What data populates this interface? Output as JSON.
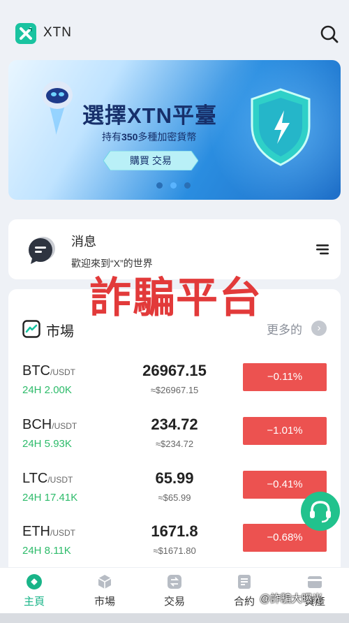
{
  "header": {
    "app_name": "XTN",
    "logo_icon": "xtn-logo-icon",
    "search_icon": "search-icon"
  },
  "banner": {
    "title": "選擇XTN平臺",
    "subtitle_prefix": "持有",
    "subtitle_count": "350",
    "subtitle_suffix": "多種加密貨幣",
    "button_label": "購買  交易",
    "slides": 3,
    "active_slide": 2
  },
  "notice": {
    "title": "消息",
    "text": "歡迎來到“X”的世界",
    "icon": "message-icon",
    "menu_icon": "menu-icon"
  },
  "overlay_text": "詐騙平台",
  "market": {
    "title": "市場",
    "more_label": "更多的",
    "more_icon": "chevron-right-icon",
    "rows": [
      {
        "symbol": "BTC",
        "quote": "/USDT",
        "volume": "24H 2.00K",
        "price": "26967.15",
        "converted": "≈$26967.15",
        "change": "−0.11%"
      },
      {
        "symbol": "BCH",
        "quote": "/USDT",
        "volume": "24H 5.93K",
        "price": "234.72",
        "converted": "≈$234.72",
        "change": "−1.01%"
      },
      {
        "symbol": "LTC",
        "quote": "/USDT",
        "volume": "24H 17.41K",
        "price": "65.99",
        "converted": "≈$65.99",
        "change": "−0.41%"
      },
      {
        "symbol": "ETH",
        "quote": "/USDT",
        "volume": "24H 8.11K",
        "price": "1671.8",
        "converted": "≈$1671.80",
        "change": "−0.68%"
      }
    ]
  },
  "support_icon": "headset-icon",
  "tabbar": {
    "tabs": [
      {
        "label": "主頁",
        "icon": "home-icon",
        "active": true
      },
      {
        "label": "市場",
        "icon": "cube-icon",
        "active": false
      },
      {
        "label": "交易",
        "icon": "exchange-icon",
        "active": false
      },
      {
        "label": "合約",
        "icon": "contract-icon",
        "active": false
      },
      {
        "label": "資產",
        "icon": "wallet-icon",
        "active": false
      }
    ]
  },
  "credit": "@詐騙大曝光",
  "colors": {
    "accent": "#19c3a0",
    "down": "#ec5250",
    "volume_green": "#2dbb6a",
    "watermark": "#e23a3a",
    "active_tab": "#19b488"
  }
}
